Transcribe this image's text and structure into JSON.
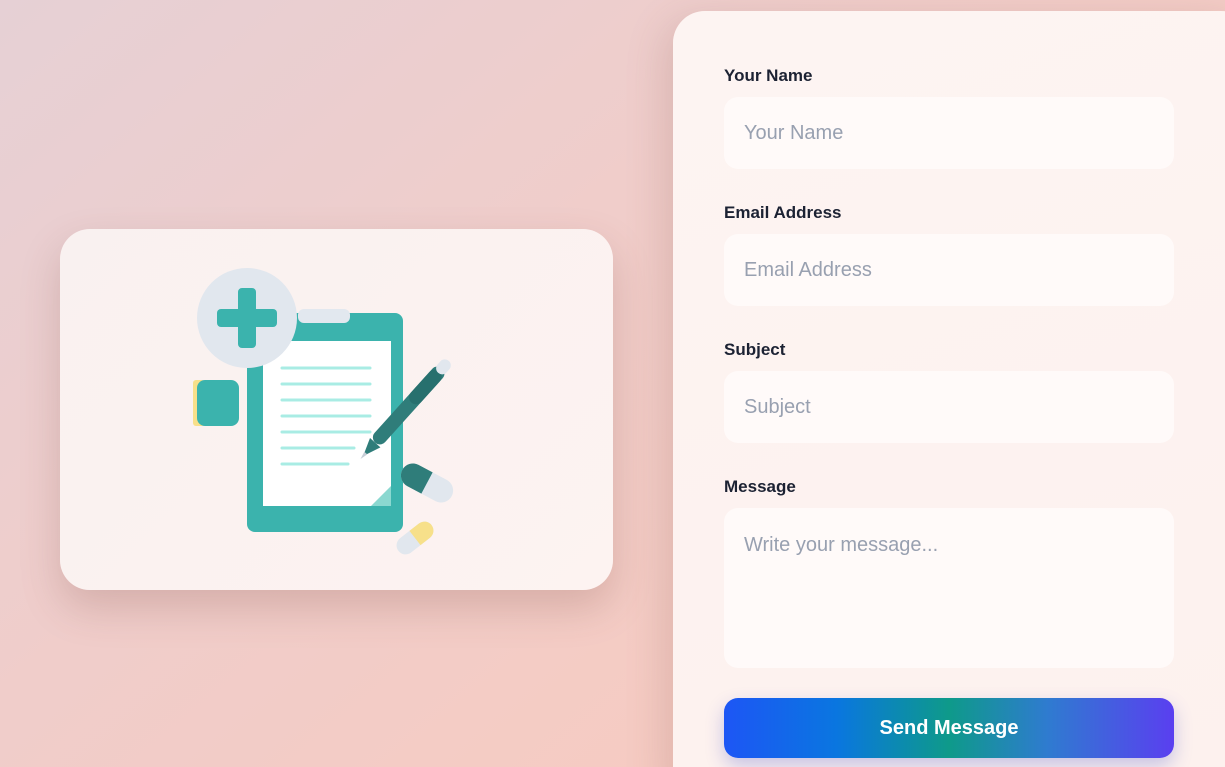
{
  "form": {
    "fields": [
      {
        "label": "Your Name",
        "placeholder": "Your Name"
      },
      {
        "label": "Email Address",
        "placeholder": "Email Address"
      },
      {
        "label": "Subject",
        "placeholder": "Subject"
      },
      {
        "label": "Message",
        "placeholder": "Write your message..."
      }
    ],
    "submit_label": "Send Message"
  },
  "colors": {
    "accent_teal": "#3bb3ad",
    "button_gradient_start": "#1d56f5",
    "button_gradient_mid": "#0e9a8a",
    "button_gradient_end": "#5a3ff0",
    "label_text": "#1c2233",
    "placeholder_text": "#98a0b0"
  },
  "illustration": {
    "icons": [
      "medical-cross-icon",
      "clipboard-icon",
      "pen-icon",
      "capsule-icon",
      "notebook-icon"
    ]
  }
}
